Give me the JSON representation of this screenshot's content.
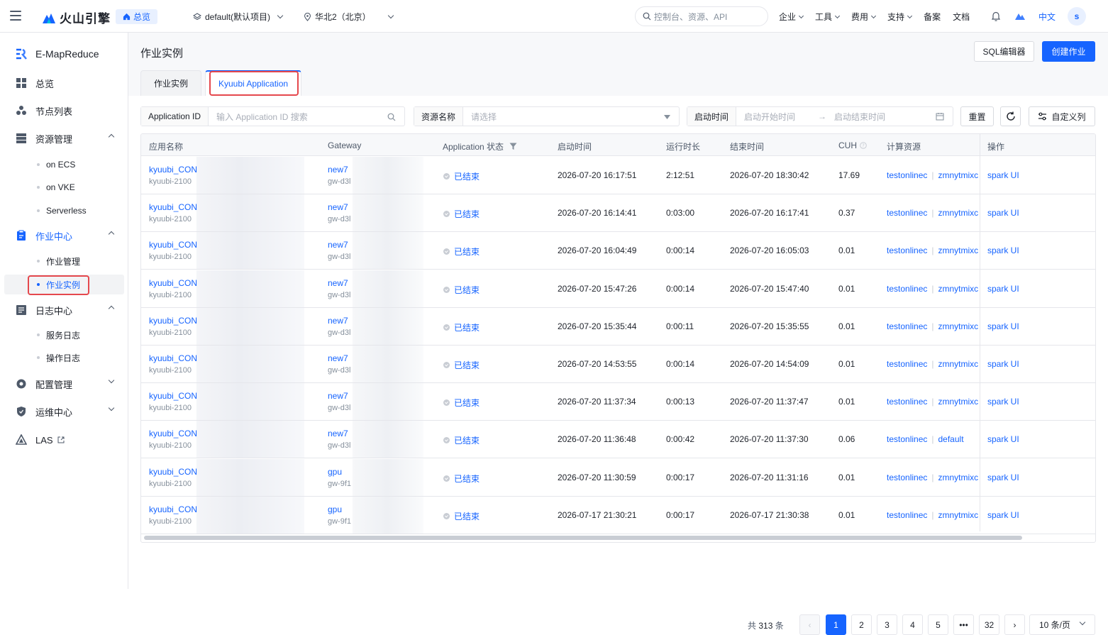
{
  "topbar": {
    "brand": "火山引擎",
    "home": "总览",
    "project": "default(默认项目)",
    "region": "华北2（北京）",
    "search_placeholder": "控制台、资源、API",
    "nav": [
      "企业",
      "工具",
      "费用",
      "支持",
      "备案",
      "文档"
    ],
    "lang": "中文",
    "avatar": "s"
  },
  "sidebar": {
    "title": "E-MapReduce",
    "overview": "总览",
    "nodes": "节点列表",
    "resource_mgmt": "资源管理",
    "resource_subs": [
      "on ECS",
      "on VKE",
      "Serverless"
    ],
    "job_center": "作业中心",
    "job_subs": [
      "作业管理",
      "作业实例"
    ],
    "log_center": "日志中心",
    "log_subs": [
      "服务日志",
      "操作日志"
    ],
    "config_mgmt": "配置管理",
    "ops_center": "运维中心",
    "las": "LAS"
  },
  "page": {
    "title": "作业实例",
    "sql_editor": "SQL编辑器",
    "create_job": "创建作业",
    "tabs": [
      "作业实例",
      "Kyuubi Application"
    ]
  },
  "filters": {
    "app_id_label": "Application ID",
    "app_id_placeholder": "输入 Application ID 搜索",
    "resource_label": "资源名称",
    "resource_placeholder": "请选择",
    "time_label": "启动时间",
    "start_placeholder": "启动开始时间",
    "end_placeholder": "启动结束时间",
    "reset": "重置",
    "custom_cols": "自定义列"
  },
  "table": {
    "headers": [
      "应用名称",
      "Gateway",
      "Application 状态",
      "启动时间",
      "运行时长",
      "结束时间",
      "CUH",
      "计算资源",
      "操作"
    ],
    "rows": [
      {
        "name": "kyuubi_CON",
        "name_sub": "kyuubi-2100",
        "gw": "new7",
        "gw_sub": "gw-d3l",
        "status": "已结束",
        "start": "2026-07-20 16:17:51",
        "dur": "2:12:51",
        "end": "2026-07-20 18:30:42",
        "cuh": "17.69",
        "res1": "testonlinec",
        "res2": "zmnytmixc",
        "op": "spark UI"
      },
      {
        "name": "kyuubi_CON",
        "name_sub": "kyuubi-2100",
        "gw": "new7",
        "gw_sub": "gw-d3l",
        "status": "已结束",
        "start": "2026-07-20 16:14:41",
        "dur": "0:03:00",
        "end": "2026-07-20 16:17:41",
        "cuh": "0.37",
        "res1": "testonlinec",
        "res2": "zmnytmixc",
        "op": "spark UI"
      },
      {
        "name": "kyuubi_CON",
        "name_sub": "kyuubi-2100",
        "gw": "new7",
        "gw_sub": "gw-d3l",
        "status": "已结束",
        "start": "2026-07-20 16:04:49",
        "dur": "0:00:14",
        "end": "2026-07-20 16:05:03",
        "cuh": "0.01",
        "res1": "testonlinec",
        "res2": "zmnytmixc",
        "op": "spark UI"
      },
      {
        "name": "kyuubi_CON",
        "name_sub": "kyuubi-2100",
        "gw": "new7",
        "gw_sub": "gw-d3l",
        "status": "已结束",
        "start": "2026-07-20 15:47:26",
        "dur": "0:00:14",
        "end": "2026-07-20 15:47:40",
        "cuh": "0.01",
        "res1": "testonlinec",
        "res2": "zmnytmixc",
        "op": "spark UI"
      },
      {
        "name": "kyuubi_CON",
        "name_sub": "kyuubi-2100",
        "gw": "new7",
        "gw_sub": "gw-d3l",
        "status": "已结束",
        "start": "2026-07-20 15:35:44",
        "dur": "0:00:11",
        "end": "2026-07-20 15:35:55",
        "cuh": "0.01",
        "res1": "testonlinec",
        "res2": "zmnytmixc",
        "op": "spark UI"
      },
      {
        "name": "kyuubi_CON",
        "name_sub": "kyuubi-2100",
        "gw": "new7",
        "gw_sub": "gw-d3l",
        "status": "已结束",
        "start": "2026-07-20 14:53:55",
        "dur": "0:00:14",
        "end": "2026-07-20 14:54:09",
        "cuh": "0.01",
        "res1": "testonlinec",
        "res2": "zmnytmixc",
        "op": "spark UI"
      },
      {
        "name": "kyuubi_CON",
        "name_sub": "kyuubi-2100",
        "gw": "new7",
        "gw_sub": "gw-d3l",
        "status": "已结束",
        "start": "2026-07-20 11:37:34",
        "dur": "0:00:13",
        "end": "2026-07-20 11:37:47",
        "cuh": "0.01",
        "res1": "testonlinec",
        "res2": "zmnytmixc",
        "op": "spark UI"
      },
      {
        "name": "kyuubi_CON",
        "name_sub": "kyuubi-2100",
        "gw": "new7",
        "gw_sub": "gw-d3l",
        "status": "已结束",
        "start": "2026-07-20 11:36:48",
        "dur": "0:00:42",
        "end": "2026-07-20 11:37:30",
        "cuh": "0.06",
        "res1": "testonlinec",
        "res2": "default",
        "op": "spark UI"
      },
      {
        "name": "kyuubi_CON",
        "name_sub": "kyuubi-2100",
        "gw": "gpu",
        "gw_sub": "gw-9f1",
        "status": "已结束",
        "start": "2026-07-20 11:30:59",
        "dur": "0:00:17",
        "end": "2026-07-20 11:31:16",
        "cuh": "0.01",
        "res1": "testonlinec",
        "res2": "zmnytmixc",
        "op": "spark UI"
      },
      {
        "name": "kyuubi_CON",
        "name_sub": "kyuubi-2100",
        "gw": "gpu",
        "gw_sub": "gw-9f1",
        "status": "已结束",
        "start": "2026-07-17 21:30:21",
        "dur": "0:00:17",
        "end": "2026-07-17 21:30:38",
        "cuh": "0.01",
        "res1": "testonlinec",
        "res2": "zmnytmixc",
        "op": "spark UI"
      }
    ]
  },
  "pagination": {
    "total_prefix": "共",
    "total": "313",
    "total_suffix": "条",
    "pages": [
      "1",
      "2",
      "3",
      "4",
      "5",
      "•••",
      "32"
    ],
    "page_size": "10 条/页"
  },
  "colors": {
    "primary": "#1664ff",
    "highlight": "#e5484d"
  }
}
